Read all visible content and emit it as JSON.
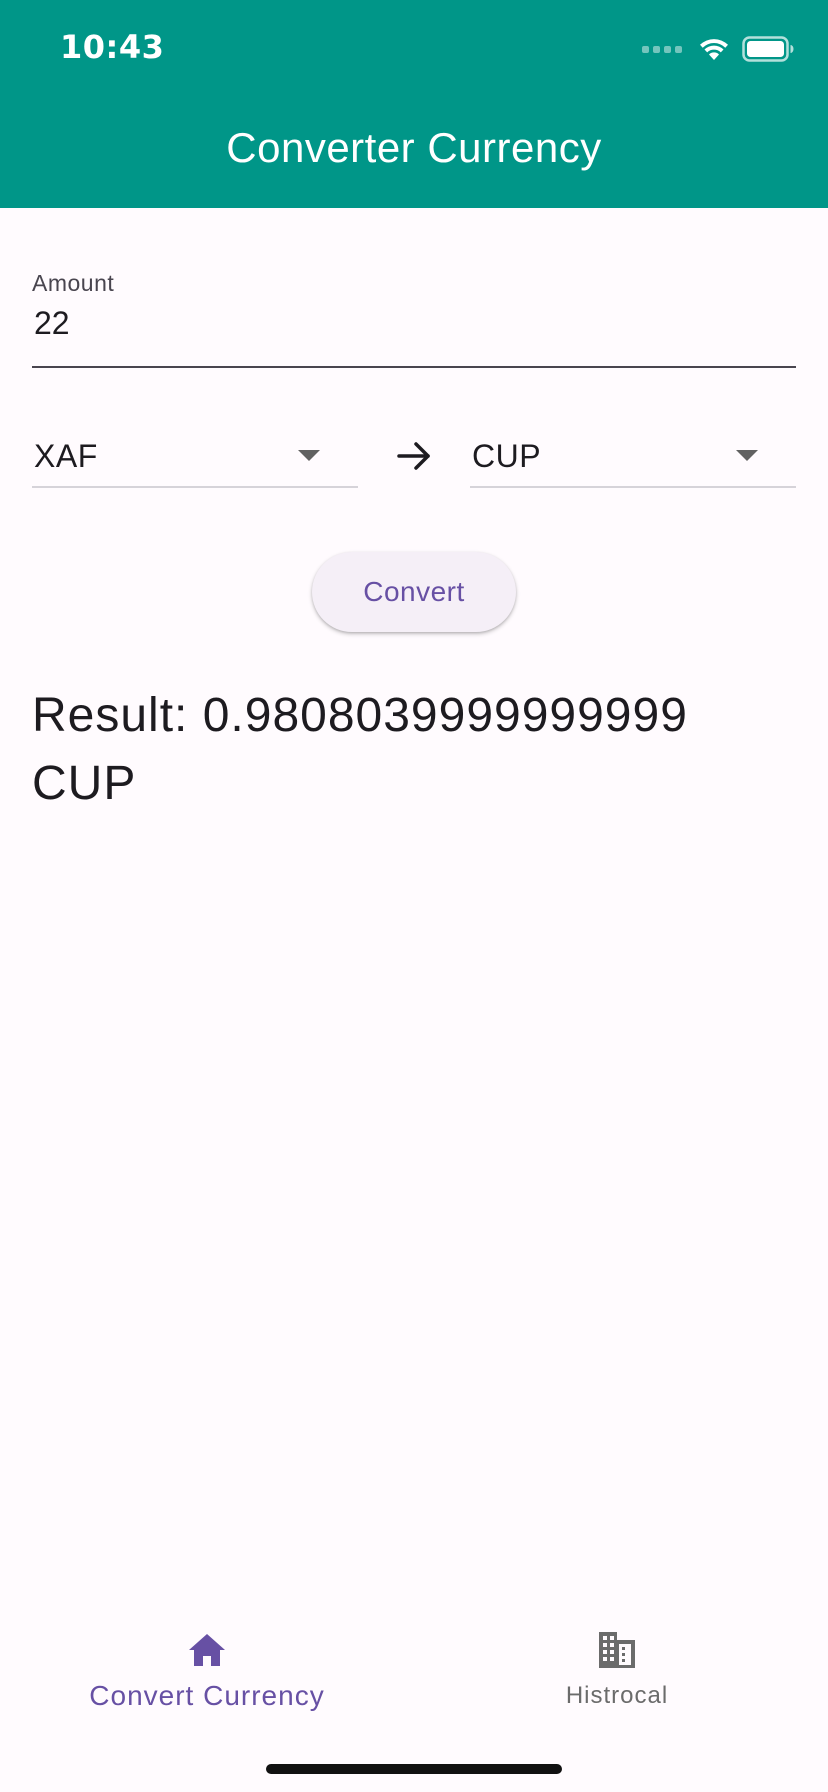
{
  "status_bar": {
    "time": "10:43",
    "icons": [
      "cellular-signal-icon",
      "wifi-icon",
      "battery-icon"
    ]
  },
  "app_bar": {
    "title": "Converter Currency",
    "color": "#009688"
  },
  "amount": {
    "label": "Amount",
    "value": "22"
  },
  "from_currency": {
    "value": "XAF"
  },
  "to_currency": {
    "value": "CUP"
  },
  "convert_button": {
    "label": "Convert"
  },
  "result": {
    "text": "Result: 0.9808039999999999 CUP"
  },
  "bottom_nav": {
    "items": [
      {
        "label": "Convert Currency",
        "icon": "home-icon",
        "selected": true
      },
      {
        "label": "Histrocal",
        "icon": "building-icon",
        "selected": false
      }
    ]
  },
  "colors": {
    "accent": "#6750a4",
    "app_bar": "#009688",
    "background": "#fffbfe"
  }
}
